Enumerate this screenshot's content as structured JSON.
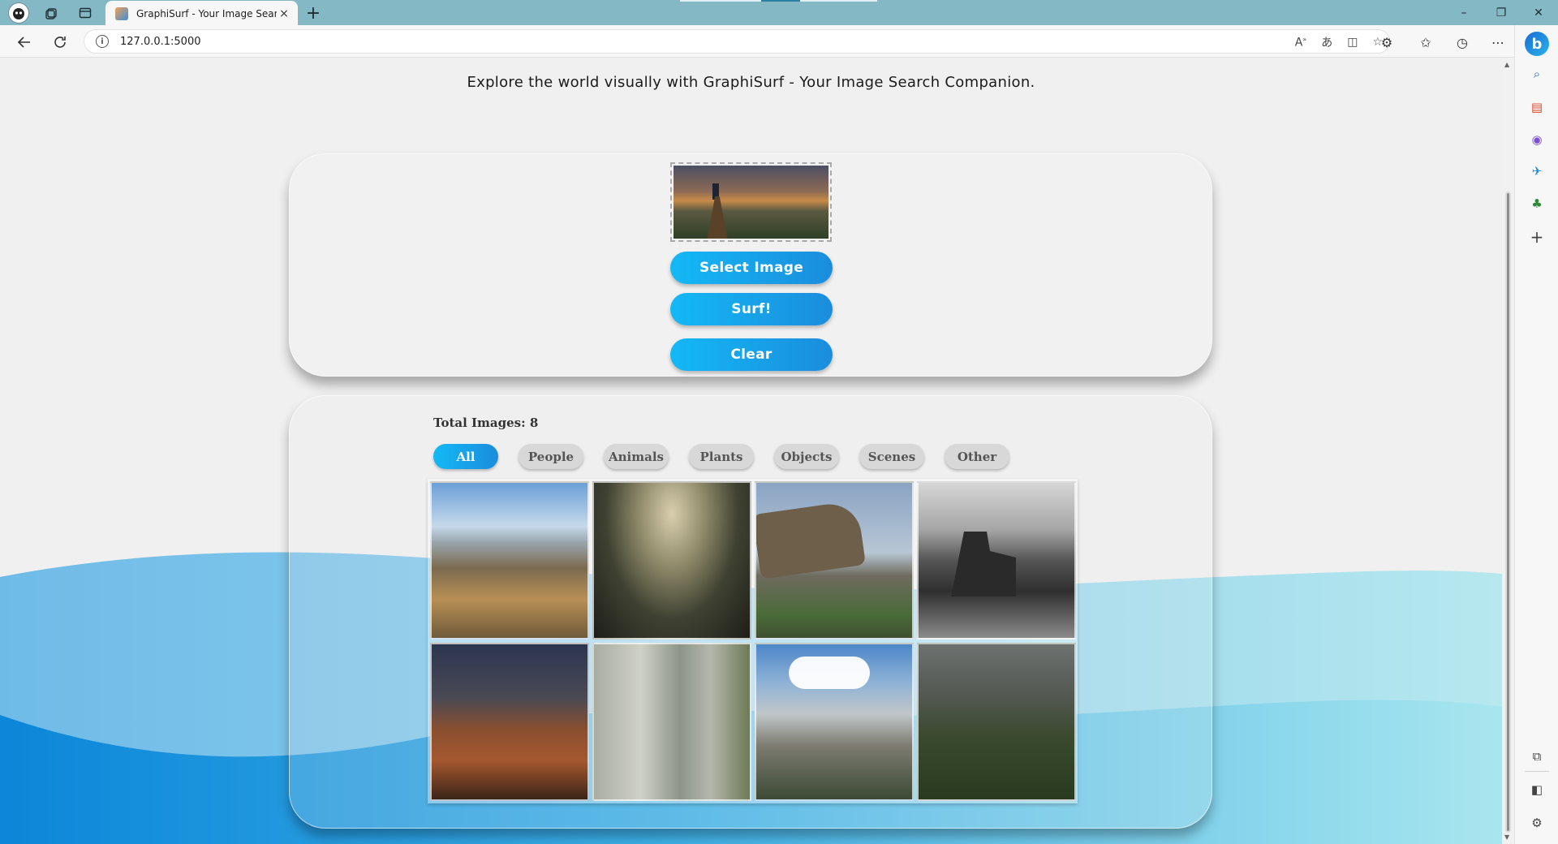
{
  "browser": {
    "tab_title": "GraphiSurf - Your Image Search Companion",
    "tab_close": "×",
    "new_tab": "+",
    "address": "127.0.0.1:5000",
    "window_controls": [
      "–",
      "❐",
      "✕"
    ],
    "toolbar_icons": [
      "read-aloud-icon",
      "translate-icon",
      "split-screen-icon",
      "favorite-star-icon"
    ],
    "right_tools": [
      "extensions-icon",
      "favorites-icon",
      "history-icon",
      "more-icon"
    ],
    "sidebar_icons": [
      "copilot-icon",
      "search-icon",
      "shopping-icon",
      "office-icon",
      "outlook-icon",
      "games-icon",
      "add-icon",
      "screenshot-icon",
      "sidebar-icon",
      "settings-icon"
    ]
  },
  "page": {
    "tagline": "Explore the world visually with GraphiSurf - Your Image Search Companion.",
    "upload": {
      "select_label": "Select Image",
      "surf_label": "Surf!",
      "clear_label": "Clear"
    },
    "results": {
      "total_label": "Total Images: 8",
      "filters": [
        "All",
        "People",
        "Animals",
        "Plants",
        "Objects",
        "Scenes",
        "Other"
      ],
      "active_filter": "All",
      "image_count": 8
    }
  },
  "colors": {
    "accent": "#14b8f5",
    "accent_dark": "#1a8ddc",
    "tabstrip": "#85b8c5"
  }
}
